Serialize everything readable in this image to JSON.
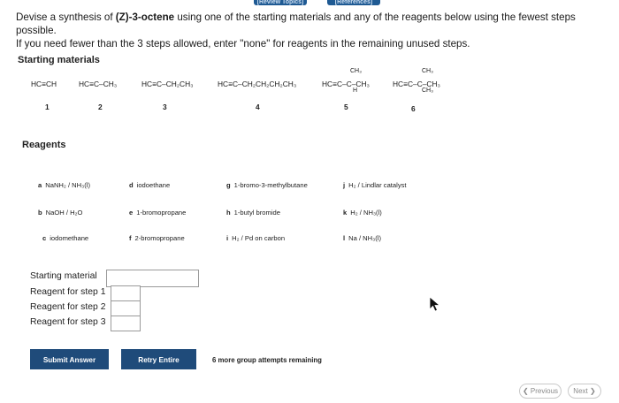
{
  "header": {
    "tab1": "[Review Topics]",
    "tab2": "[References]"
  },
  "question": {
    "line1_pre": "Devise a synthesis of ",
    "target": "(Z)-3-octene",
    "line1_post": " using one of the starting materials and any of the reagents below using the fewest steps possible.",
    "line2": "If you need fewer than the 3 steps allowed, enter \"none\" for reagents in the remaining unused steps."
  },
  "starting_materials": {
    "title": "Starting materials",
    "items": [
      {
        "formula": "HC≡CH",
        "number": "1"
      },
      {
        "formula": "HC≡C–CH₃",
        "number": "2"
      },
      {
        "formula": "HC≡C–CH₂CH₃",
        "number": "3"
      },
      {
        "formula": "HC≡C–CH₂CH₂CH₂CH₃",
        "number": "4"
      },
      {
        "formula": "HC≡C–C–CH₃",
        "top": "CH₃",
        "bottom": "H",
        "number": "5"
      },
      {
        "formula": "HC≡C–C–CH₃",
        "top": "CH₃",
        "bottom": "CH₃",
        "number": "6"
      }
    ]
  },
  "reagents": {
    "title": "Reagents",
    "items": [
      {
        "key": "a",
        "label": "NaNH₂ / NH₃(l)"
      },
      {
        "key": "b",
        "label": "NaOH / H₂O"
      },
      {
        "key": "c",
        "label": "iodomethane"
      },
      {
        "key": "d",
        "label": "iodoethane"
      },
      {
        "key": "e",
        "label": "1-bromopropane"
      },
      {
        "key": "f",
        "label": "2-bromopropane"
      },
      {
        "key": "g",
        "label": "1-bromo-3-methylbutane"
      },
      {
        "key": "h",
        "label": "1-butyl bromide"
      },
      {
        "key": "i",
        "label": "H₂ / Pd on carbon"
      },
      {
        "key": "j",
        "label": "H₂ / Lindlar catalyst"
      },
      {
        "key": "k",
        "label": "H₂ / NH₃(l)"
      },
      {
        "key": "l",
        "label": "Na / NH₃(l)"
      }
    ]
  },
  "answers": {
    "starting_material_label": "Starting material",
    "step1_label": "Reagent for step 1",
    "step2_label": "Reagent for step 2",
    "step3_label": "Reagent for step 3",
    "starting_material_value": "",
    "step1_value": "",
    "step2_value": "",
    "step3_value": ""
  },
  "buttons": {
    "submit": "Submit Answer",
    "retry": "Retry Entire Group",
    "attempts": "6 more group attempts remaining",
    "previous": "Previous",
    "next": "Next"
  },
  "colors": {
    "primary": "#1f4b7a",
    "header": "#1f5a93"
  }
}
